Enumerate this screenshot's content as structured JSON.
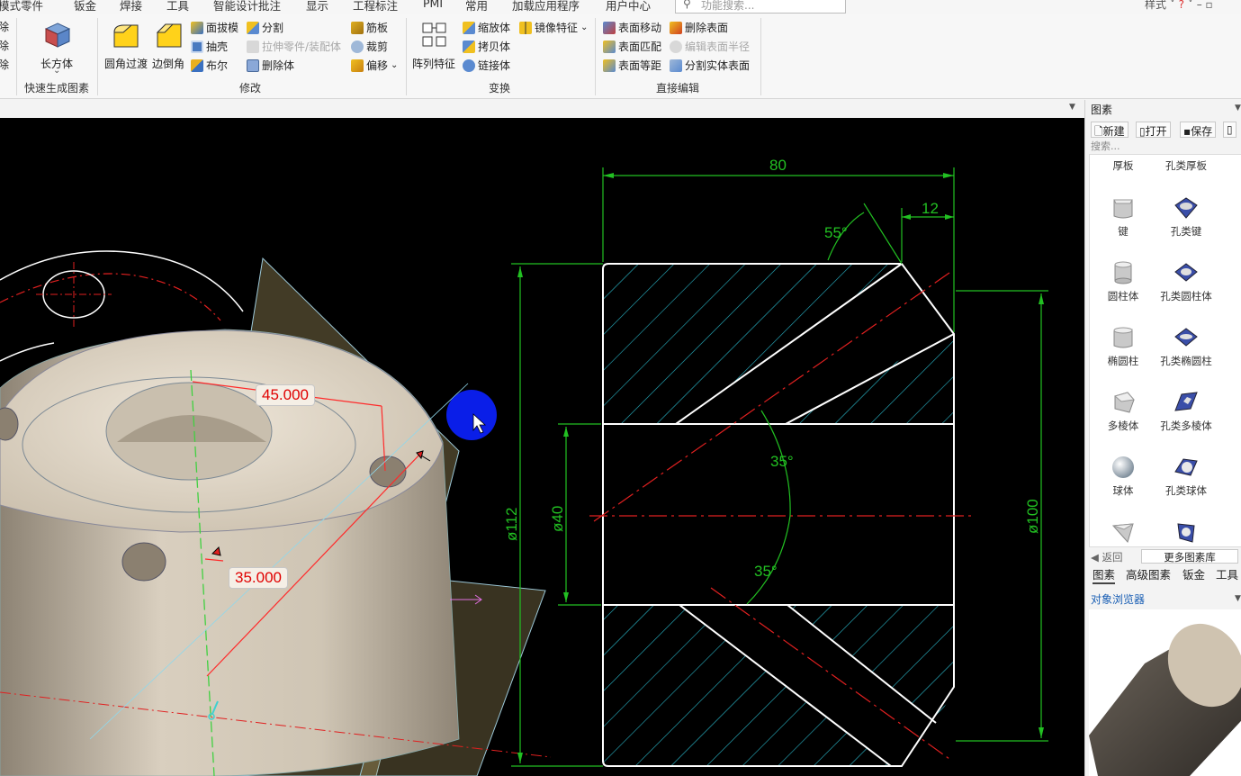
{
  "menu": {
    "items": [
      "模式零件",
      "钣金",
      "焊接",
      "工具",
      "智能设计批注",
      "显示",
      "工程标注",
      "PMI",
      "常用",
      "加载应用程序",
      "用户中心"
    ],
    "search_placeholder": "功能搜索...",
    "style_label": "样式"
  },
  "ribbon": {
    "left_cut_items": [
      "除",
      "除",
      "除"
    ],
    "quick_group": {
      "label": "快速生成图素",
      "box_label": "长方体"
    },
    "modify_group": {
      "label": "修改",
      "fillet_label": "圆角过渡",
      "chamfer_label": "边倒角",
      "items": [
        "面拔模",
        "抽壳",
        "布尔",
        "分割",
        "拉伸零件/装配体",
        "删除体",
        "筋板",
        "裁剪",
        "偏移"
      ]
    },
    "transform_group": {
      "label": "变换",
      "pattern_label": "阵列特征",
      "items": [
        "缩放体",
        "拷贝体",
        "链接体",
        "镜像特征"
      ]
    },
    "direct_edit_group": {
      "label": "直接编辑",
      "items": [
        "表面移动",
        "表面匹配",
        "表面等距",
        "删除表面",
        "编辑表面半径",
        "分割实体表面"
      ]
    }
  },
  "viewport": {
    "dim_45": "45.000",
    "dim_35": "35.000",
    "drawing": {
      "dim_80": "80",
      "dim_12": "12",
      "angle_55": "55°",
      "angle_35_top": "35°",
      "angle_35_bottom": "35°",
      "dia_112": "ø112",
      "dia_40": "ø40",
      "dia_100": "ø100"
    }
  },
  "panel": {
    "title": "图素",
    "toolbar": [
      "新建",
      "打开",
      "保存"
    ],
    "search_placeholder": "搜索...",
    "categories": [
      "厚板",
      "孔类厚板"
    ],
    "items": [
      {
        "left": "键",
        "right": "孔类键"
      },
      {
        "left": "圆柱体",
        "right": "孔类圆柱体"
      },
      {
        "left": "椭圆柱",
        "right": "孔类椭圆柱"
      },
      {
        "left": "多棱体",
        "right": "孔类多棱体"
      },
      {
        "left": "球体",
        "right": "孔类球体"
      }
    ],
    "back_label": "返回",
    "more_label": "更多图素库",
    "tabs": [
      "图素",
      "高级图素",
      "钣金",
      "工具"
    ],
    "browser_title": "对象浏览器"
  }
}
